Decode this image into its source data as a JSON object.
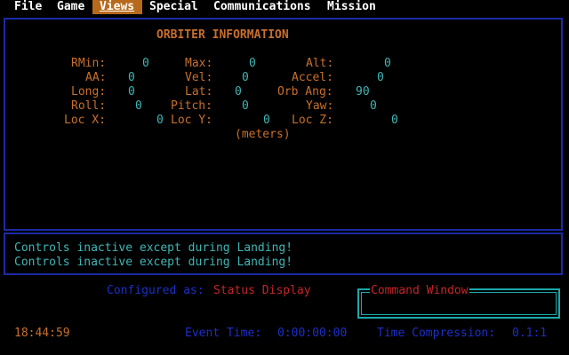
{
  "menu": {
    "items": [
      {
        "label": "File"
      },
      {
        "label": "Game"
      },
      {
        "label": "Views"
      },
      {
        "label": "Special"
      },
      {
        "label": "Communications"
      },
      {
        "label": "Mission"
      }
    ],
    "selected": "Views"
  },
  "orbiter": {
    "title": "ORBITER INFORMATION",
    "fields": {
      "rmin": {
        "label": "RMin:",
        "value": "0"
      },
      "max": {
        "label": "Max:",
        "value": "0"
      },
      "alt": {
        "label": "Alt:",
        "value": "0"
      },
      "aa": {
        "label": "AA:",
        "value": "0"
      },
      "vel": {
        "label": "Vel:",
        "value": "0"
      },
      "accel": {
        "label": "Accel:",
        "value": "0"
      },
      "long": {
        "label": "Long:",
        "value": "0"
      },
      "lat": {
        "label": "Lat:",
        "value": "0"
      },
      "orb_ang": {
        "label": "Orb Ang:",
        "value": "90"
      },
      "roll": {
        "label": "Roll:",
        "value": "0"
      },
      "pitch": {
        "label": "Pitch:",
        "value": "0"
      },
      "yaw": {
        "label": "Yaw:",
        "value": "0"
      },
      "loc_x": {
        "label": "Loc X:",
        "value": "0"
      },
      "loc_y": {
        "label": "Loc Y:",
        "value": "0"
      },
      "loc_z": {
        "label": "Loc Z:",
        "value": "0"
      }
    },
    "units": "(meters)"
  },
  "messages": [
    "Controls inactive except during Landing!",
    "Controls inactive except during Landing!"
  ],
  "status": {
    "configured_label": "Configured as:",
    "configured_value": "Status Display",
    "command_window_label": "Command Window",
    "clock": "18:44:59",
    "event_time_label": "Event Time:",
    "event_time_value": "0:00:00:00",
    "time_compression_label": "Time Compression:",
    "time_compression_value": "0.1:1"
  },
  "colors": {
    "label": "#c96f2a",
    "value": "#3fb6b6",
    "border": "#1c2aa6",
    "menu_highlight": "#b86a1c"
  }
}
